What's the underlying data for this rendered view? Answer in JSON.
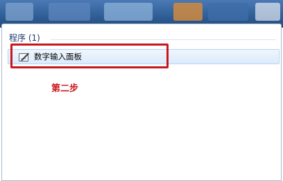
{
  "start_menu": {
    "section_header": "程序 (1)",
    "results": [
      {
        "label": "数字输入面板",
        "icon": "pen-pad-icon"
      }
    ]
  },
  "annotation": {
    "text": "第二步",
    "color": "#c8171b"
  },
  "colors": {
    "highlight": "#c8171b",
    "header_text": "#1e3a6e",
    "selected_item": "#dcebfc"
  }
}
